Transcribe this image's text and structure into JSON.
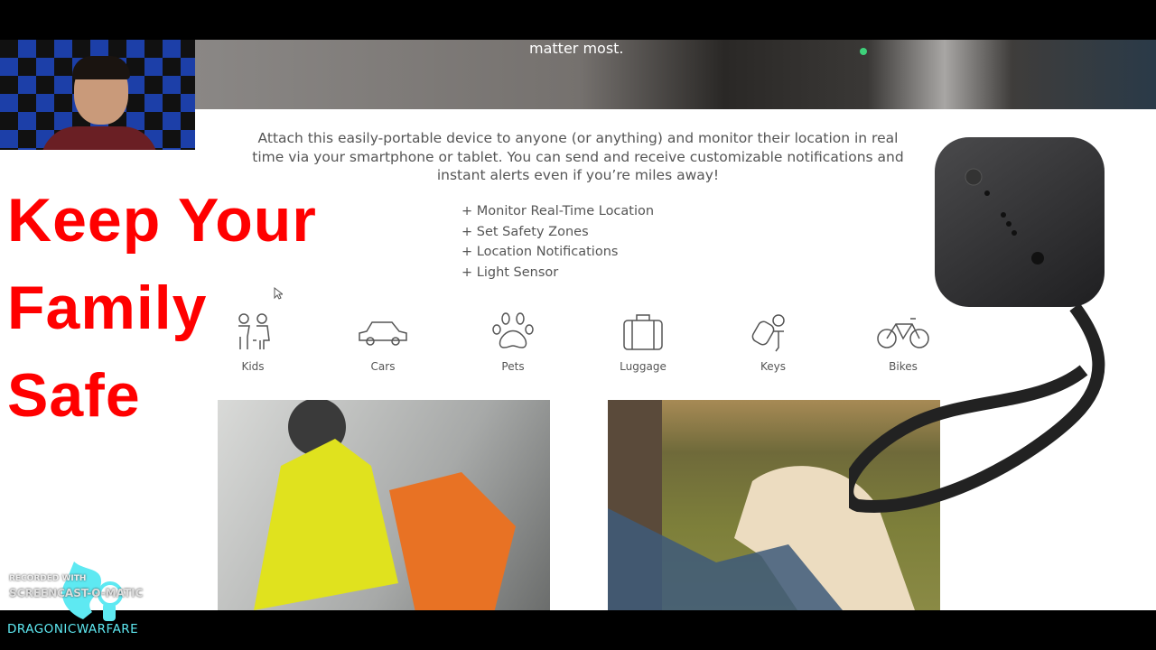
{
  "hero": {
    "text": "matter most."
  },
  "description": "Attach this easily-portable device to anyone (or anything) and monitor their location in real time via your smartphone or tablet. You can send and receive customizable notifications and instant alerts even if you’re miles away!",
  "features": [
    "+ Monitor Real-Time Location",
    "+ Set Safety Zones",
    "+ Location Notifications",
    "+ Light Sensor"
  ],
  "categories": [
    {
      "label": "Kids",
      "icon": "kids-icon"
    },
    {
      "label": "Cars",
      "icon": "car-icon"
    },
    {
      "label": "Pets",
      "icon": "paw-icon"
    },
    {
      "label": "Luggage",
      "icon": "luggage-icon"
    },
    {
      "label": "Keys",
      "icon": "keys-icon"
    },
    {
      "label": "Bikes",
      "icon": "bike-icon"
    }
  ],
  "headline": {
    "line1": "Keep Your",
    "line2": "Family",
    "line3": "Safe",
    "color": "#ff0000"
  },
  "watermark": {
    "small": "RECORDED WITH",
    "brand": "SCREENCAST-O-MATIC"
  },
  "channel": {
    "name": "DRAGONICWARFARE",
    "color": "#5ee9f2"
  }
}
